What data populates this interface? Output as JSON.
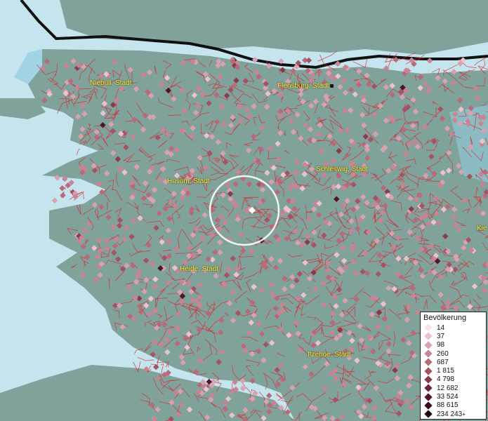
{
  "cities": [
    {
      "name": "Niebüll, Stadt"
    },
    {
      "name": "Flensburg, Stadt"
    },
    {
      "name": "Husum, Stadt"
    },
    {
      "name": "Schleswig, Stadt"
    },
    {
      "name": "Heide, Stadt"
    },
    {
      "name": "Itzehoe, Stadt"
    },
    {
      "name": "Kie"
    }
  ],
  "legend": {
    "title": "Bevölkerung",
    "items": [
      {
        "label": "14",
        "color": "#f6e2ea"
      },
      {
        "label": "37",
        "color": "#ebc2cf"
      },
      {
        "label": "98",
        "color": "#d9a0b0"
      },
      {
        "label": "260",
        "color": "#c98493"
      },
      {
        "label": "687",
        "color": "#b86a7a"
      },
      {
        "label": "1 815",
        "color": "#a55263"
      },
      {
        "label": "4 798",
        "color": "#8c3a4a"
      },
      {
        "label": "12 682",
        "color": "#6e2434"
      },
      {
        "label": "33 524",
        "color": "#521424"
      },
      {
        "label": "88 615",
        "color": "#3a0a16"
      },
      {
        "label": "234 243",
        "color": "#1c040a",
        "suffix": "+"
      }
    ]
  },
  "colors": {
    "sea": "#bfe2ec",
    "shallow": "#8ccbe0",
    "land": "#7fa39b",
    "boundary": "#e0202a",
    "border": "#111111",
    "marker_white": "#ffffff"
  }
}
